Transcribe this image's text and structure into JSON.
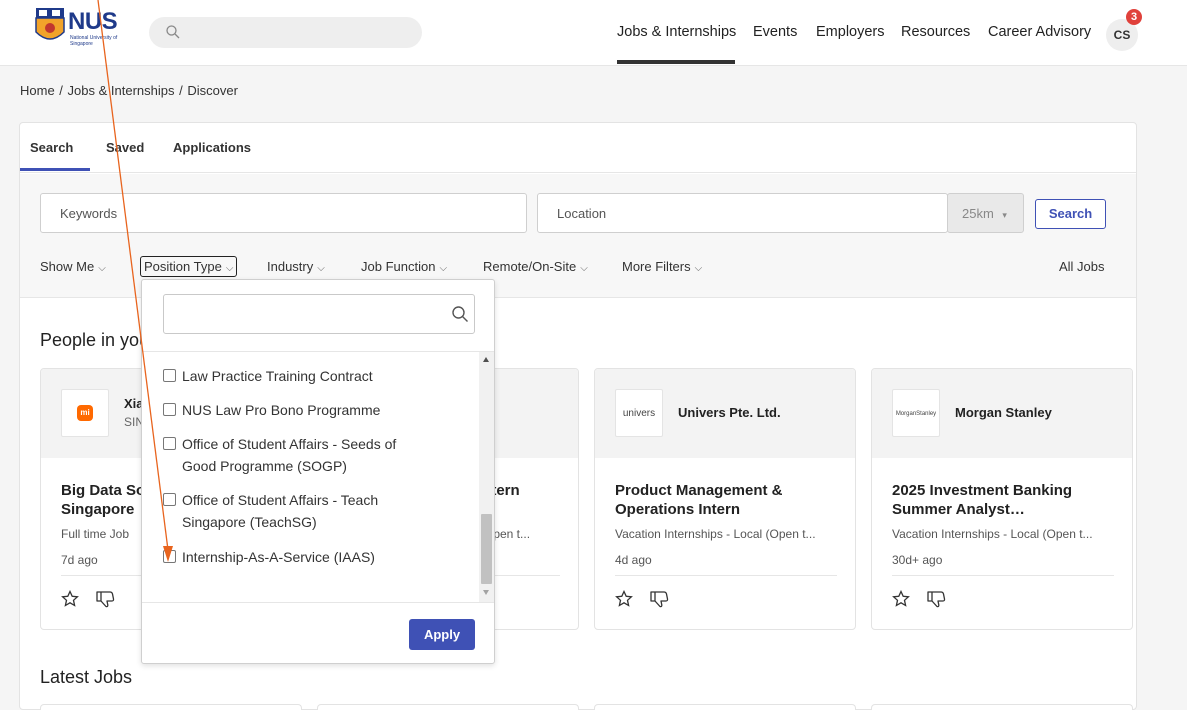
{
  "header": {
    "logo_text": "NUS",
    "logo_subtext": "National University of Singapore",
    "nav": [
      "Jobs & Internships",
      "Events",
      "Employers",
      "Resources",
      "Career Advisory"
    ],
    "active_nav": "Jobs & Internships",
    "avatar_initials": "CS",
    "notification_count": "3"
  },
  "breadcrumb": [
    "Home",
    "Jobs & Internships",
    "Discover"
  ],
  "tabs": [
    "Search",
    "Saved",
    "Applications"
  ],
  "active_tab": "Search",
  "search": {
    "keywords_placeholder": "Keywords",
    "location_placeholder": "Location",
    "radius": "25km",
    "search_label": "Search"
  },
  "filters": [
    "Show Me",
    "Position Type",
    "Industry",
    "Job Function",
    "Remote/On-Site",
    "More Filters"
  ],
  "active_filter": "Position Type",
  "all_jobs_label": "All Jobs",
  "section_people": "People in you",
  "section_latest": "Latest Jobs",
  "job_cards": [
    {
      "logo_text": "mi",
      "company": "Xia",
      "company_sub": "SIN",
      "title": "Big Data So\nSingapore",
      "type": "Full time Job",
      "age": "7d ago"
    },
    {
      "logo_text": "",
      "company": "",
      "company_sub": "",
      "title": "Intern",
      "type": "l (Open t...",
      "age": ""
    },
    {
      "logo_text": "univers",
      "company": "Univers Pte. Ltd.",
      "company_sub": "",
      "title": "Product Management & Operations Intern",
      "type": "Vacation Internships - Local (Open t...",
      "age": "4d ago"
    },
    {
      "logo_text": "MorganStanley",
      "company": "Morgan Stanley",
      "company_sub": "",
      "title": "2025 Investment Banking Summer Analyst…",
      "type": "Vacation Internships - Local (Open t...",
      "age": "30d+ ago"
    }
  ],
  "position_dropdown": {
    "options": [
      "Law Practice Training Contract",
      "NUS Law Pro Bono Programme",
      "Office of Student Affairs - Seeds of Good Programme (SOGP)",
      "Office of Student Affairs - Teach Singapore (TeachSG)",
      "Internship-As-A-Service (IAAS)"
    ],
    "apply_label": "Apply"
  },
  "colors": {
    "accent": "#3f51b5",
    "badge": "#e0413b",
    "annotation": "#e8641e"
  }
}
